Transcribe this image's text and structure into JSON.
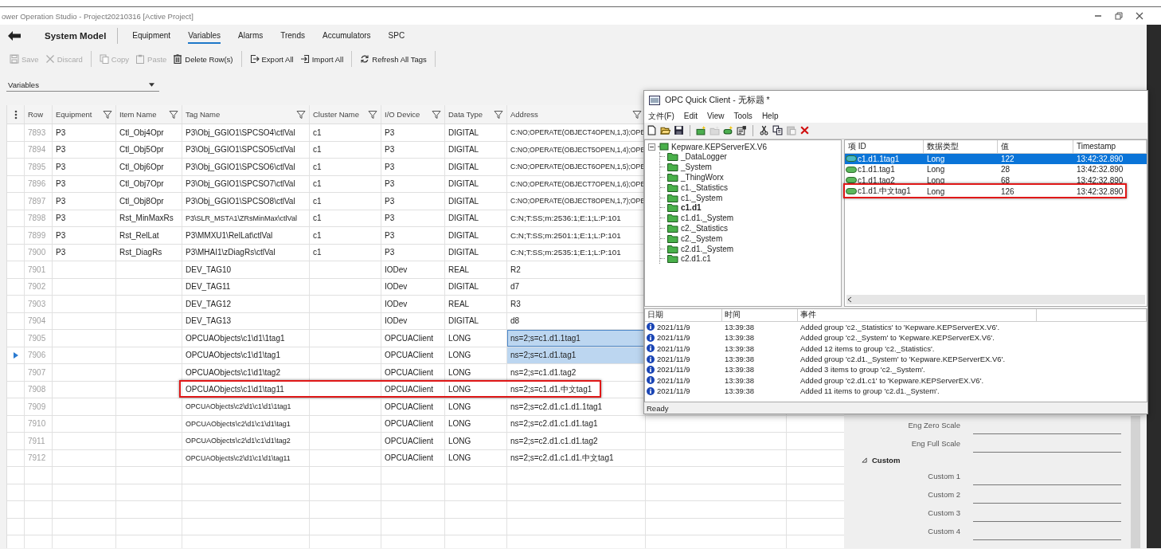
{
  "window": {
    "title": "ower Operation Studio - Project20210316 [Active Project]"
  },
  "nav": {
    "title": "System Model",
    "tabs": [
      {
        "label": "Equipment",
        "selected": false
      },
      {
        "label": "Variables",
        "selected": true
      },
      {
        "label": "Alarms",
        "selected": false
      },
      {
        "label": "Trends",
        "selected": false
      },
      {
        "label": "Accumulators",
        "selected": false
      },
      {
        "label": "SPC",
        "selected": false
      }
    ]
  },
  "toolbar": {
    "groups": [
      {
        "buttons": [
          {
            "kind": "save",
            "label": "Save",
            "disabled": true
          },
          {
            "kind": "discard",
            "label": "Discard",
            "disabled": true
          }
        ]
      },
      {
        "buttons": [
          {
            "kind": "copy",
            "label": "Copy",
            "disabled": true
          },
          {
            "kind": "paste",
            "label": "Paste",
            "disabled": true
          },
          {
            "kind": "delete",
            "label": "Delete Row(s)",
            "disabled": false
          }
        ]
      },
      {
        "buttons": [
          {
            "kind": "export",
            "label": "Export All",
            "disabled": false
          },
          {
            "kind": "import",
            "label": "Import All",
            "disabled": false
          }
        ]
      },
      {
        "buttons": [
          {
            "kind": "refresh",
            "label": "Refresh All Tags",
            "disabled": false
          }
        ]
      }
    ]
  },
  "filter": {
    "value": "Variables"
  },
  "table": {
    "columns": [
      {
        "label": "Row",
        "filter": false
      },
      {
        "label": "Equipment",
        "filter": true
      },
      {
        "label": "Item Name",
        "filter": true
      },
      {
        "label": "Tag Name",
        "filter": true
      },
      {
        "label": "Cluster Name",
        "filter": true
      },
      {
        "label": "I/O Device",
        "filter": true
      },
      {
        "label": "Data Type",
        "filter": true
      },
      {
        "label": "Address",
        "filter": true
      }
    ],
    "rows": [
      {
        "row": "7893",
        "equipment": "P3",
        "item_name": "Ctl_Obj4Opr",
        "tag_name": "P3\\Obj_GGIO1\\SPCSO4\\ctlVal",
        "cluster_name": "c1",
        "io_device": "P3",
        "data_type": "DIGITAL",
        "address": "C:NO;OPERATE(OBJECT4OPEN,1,3);OPE",
        "selected": false,
        "current": false,
        "outlined": false
      },
      {
        "row": "7894",
        "equipment": "P3",
        "item_name": "Ctl_Obj5Opr",
        "tag_name": "P3\\Obj_GGIO1\\SPCSO5\\ctlVal",
        "cluster_name": "c1",
        "io_device": "P3",
        "data_type": "DIGITAL",
        "address": "C:NO;OPERATE(OBJECT5OPEN,1,4);OPE",
        "selected": false,
        "current": false,
        "outlined": false
      },
      {
        "row": "7895",
        "equipment": "P3",
        "item_name": "Ctl_Obj6Opr",
        "tag_name": "P3\\Obj_GGIO1\\SPCSO6\\ctlVal",
        "cluster_name": "c1",
        "io_device": "P3",
        "data_type": "DIGITAL",
        "address": "C:NO;OPERATE(OBJECT6OPEN,1,5);OPE",
        "selected": false,
        "current": false,
        "outlined": false
      },
      {
        "row": "7896",
        "equipment": "P3",
        "item_name": "Ctl_Obj7Opr",
        "tag_name": "P3\\Obj_GGIO1\\SPCSO7\\ctlVal",
        "cluster_name": "c1",
        "io_device": "P3",
        "data_type": "DIGITAL",
        "address": "C:NO;OPERATE(OBJECT7OPEN,1,6);OPE",
        "selected": false,
        "current": false,
        "outlined": false
      },
      {
        "row": "7897",
        "equipment": "P3",
        "item_name": "Ctl_Obj8Opr",
        "tag_name": "P3\\Obj_GGIO1\\SPCSO8\\ctlVal",
        "cluster_name": "c1",
        "io_device": "P3",
        "data_type": "DIGITAL",
        "address": "C:NO;OPERATE(OBJECT8OPEN,1,7);OPE",
        "selected": false,
        "current": false,
        "outlined": false
      },
      {
        "row": "7898",
        "equipment": "P3",
        "item_name": "Rst_MinMaxRs",
        "tag_name": "P3\\SLR_MSTA1\\ZRsMinMax\\ctlVal",
        "cluster_name": "c1",
        "io_device": "P3",
        "data_type": "DIGITAL",
        "address": "C:N;T:SS;m:2536:1;E:1;L:P:101",
        "selected": false,
        "current": false,
        "outlined": false
      },
      {
        "row": "7899",
        "equipment": "P3",
        "item_name": "Rst_RelLat",
        "tag_name": "P3\\MMXU1\\RelLat\\ctlVal",
        "cluster_name": "c1",
        "io_device": "P3",
        "data_type": "DIGITAL",
        "address": "C:N;T:SS;m:2501:1;E:1;L:P:101",
        "selected": false,
        "current": false,
        "outlined": false
      },
      {
        "row": "7900",
        "equipment": "P3",
        "item_name": "Rst_DiagRs",
        "tag_name": "P3\\MHAI1\\zDiagRs\\ctlVal",
        "cluster_name": "c1",
        "io_device": "P3",
        "data_type": "DIGITAL",
        "address": "C:N;T:SS;m:2535:1;E:1;L:P:101",
        "selected": false,
        "current": false,
        "outlined": false
      },
      {
        "row": "7901",
        "tag_name": "DEV_TAG10",
        "io_device": "IODev",
        "data_type": "REAL",
        "address": "R2",
        "selected": false,
        "current": false,
        "outlined": false
      },
      {
        "row": "7902",
        "tag_name": "DEV_TAG11",
        "io_device": "IODev",
        "data_type": "DIGITAL",
        "address": "d7",
        "selected": false,
        "current": false,
        "outlined": false
      },
      {
        "row": "7903",
        "tag_name": "DEV_TAG12",
        "io_device": "IODev",
        "data_type": "REAL",
        "address": "R3",
        "selected": false,
        "current": false,
        "outlined": false
      },
      {
        "row": "7904",
        "tag_name": "DEV_TAG13",
        "io_device": "IODev",
        "data_type": "DIGITAL",
        "address": "d8",
        "selected": false,
        "current": false,
        "outlined": false
      },
      {
        "row": "7905",
        "tag_name": "OPCUAObjects\\c1\\d1\\1tag1",
        "io_device": "OPCUAClient",
        "data_type": "LONG",
        "address": "ns=2;s=c1.d1.1tag1",
        "selected": true,
        "current": false,
        "outlined": false
      },
      {
        "row": "7906",
        "tag_name": "OPCUAObjects\\c1\\d1\\tag1",
        "io_device": "OPCUAClient",
        "data_type": "LONG",
        "address": "ns=2;s=c1.d1.tag1",
        "selected": true,
        "current": true,
        "outlined": false
      },
      {
        "row": "7907",
        "tag_name": "OPCUAObjects\\c1\\d1\\tag2",
        "io_device": "OPCUAClient",
        "data_type": "LONG",
        "address": "ns=2;s=c1.d1.tag2",
        "selected": false,
        "current": false,
        "outlined": false
      },
      {
        "row": "7908",
        "tag_name": "OPCUAObjects\\c1\\d1\\tag11",
        "io_device": "OPCUAClient",
        "data_type": "LONG",
        "address": "ns=2;s=c1.d1.中文tag1",
        "selected": false,
        "current": false,
        "outlined": true
      },
      {
        "row": "7909",
        "tag_name": "OPCUAObjects\\c2\\d1\\c1\\d1\\1tag1",
        "io_device": "OPCUAClient",
        "data_type": "LONG",
        "address": "ns=2;s=c2.d1.c1.d1.1tag1",
        "selected": false,
        "current": false,
        "outlined": false
      },
      {
        "row": "7910",
        "tag_name": "OPCUAObjects\\c2\\d1\\c1\\d1\\tag1",
        "io_device": "OPCUAClient",
        "data_type": "LONG",
        "address": "ns=2;s=c2.d1.c1.d1.tag1",
        "selected": false,
        "current": false,
        "outlined": false
      },
      {
        "row": "7911",
        "tag_name": "OPCUAObjects\\c2\\d1\\c1\\d1\\tag2",
        "io_device": "OPCUAClient",
        "data_type": "LONG",
        "address": "ns=2;s=c2.d1.c1.d1.tag2",
        "selected": false,
        "current": false,
        "outlined": false
      },
      {
        "row": "7912",
        "tag_name": "OPCUAObjects\\c2\\d1\\c1\\d1\\tag11",
        "io_device": "OPCUAClient",
        "data_type": "LONG",
        "address": "ns=2;s=c2.d1.c1.d1.中文tag1",
        "selected": false,
        "current": false,
        "outlined": false
      }
    ]
  },
  "properties": {
    "items": [
      {
        "kind": "field",
        "label": "Eng Zero Scale"
      },
      {
        "kind": "field",
        "label": "Eng Full Scale"
      },
      {
        "kind": "section",
        "label": "Custom",
        "expanded": true
      },
      {
        "kind": "field",
        "label": "Custom 1"
      },
      {
        "kind": "field",
        "label": "Custom 2"
      },
      {
        "kind": "field",
        "label": "Custom 3"
      },
      {
        "kind": "field",
        "label": "Custom 4"
      }
    ]
  },
  "opc_client": {
    "title": "OPC Quick Client - 无标题 *",
    "menu": [
      "文件(F)",
      "Edit",
      "View",
      "Tools",
      "Help"
    ],
    "toolbar": [
      {
        "kind": "new",
        "disabled": false
      },
      {
        "kind": "open",
        "disabled": false
      },
      {
        "kind": "save",
        "disabled": false
      },
      {
        "kind": "separator"
      },
      {
        "kind": "server",
        "disabled": false
      },
      {
        "kind": "group",
        "disabled": true
      },
      {
        "kind": "item",
        "disabled": false
      },
      {
        "kind": "properties",
        "disabled": false
      },
      {
        "kind": "separator"
      },
      {
        "kind": "cut",
        "disabled": false
      },
      {
        "kind": "copy",
        "disabled": false
      },
      {
        "kind": "paste",
        "disabled": true
      },
      {
        "kind": "delete",
        "disabled": false
      }
    ],
    "tree": {
      "label": "Kepware.KEPServerEX.V6",
      "expanded": true,
      "children": [
        {
          "label": "_DataLogger",
          "selected": false
        },
        {
          "label": "_System",
          "selected": false
        },
        {
          "label": "_ThingWorx",
          "selected": false
        },
        {
          "label": "c1._Statistics",
          "selected": false
        },
        {
          "label": "c1._System",
          "selected": false
        },
        {
          "label": "c1.d1",
          "selected": true
        },
        {
          "label": "c1.d1._System",
          "selected": false
        },
        {
          "label": "c2._Statistics",
          "selected": false
        },
        {
          "label": "c2._System",
          "selected": false
        },
        {
          "label": "c2.d1._System",
          "selected": false
        },
        {
          "label": "c2.d1.c1",
          "selected": false
        }
      ]
    },
    "items": {
      "columns": [
        "项 ID",
        "数据类型",
        "值",
        "Timestamp"
      ],
      "rows": [
        {
          "id": "c1.d1.1tag1",
          "type": "Long",
          "value": "122",
          "timestamp": "13:42:32.890",
          "selected": true,
          "outlined": false
        },
        {
          "id": "c1.d1.tag1",
          "type": "Long",
          "value": "28",
          "timestamp": "13:42:32.890",
          "selected": false,
          "outlined": false
        },
        {
          "id": "c1.d1.tag2",
          "type": "Long",
          "value": "68",
          "timestamp": "13:42:32.890",
          "selected": false,
          "outlined": false
        },
        {
          "id": "c1.d1.中文tag1",
          "type": "Long",
          "value": "126",
          "timestamp": "13:42:32.890",
          "selected": false,
          "outlined": true
        }
      ]
    },
    "log": {
      "columns": [
        "日期",
        "时间",
        "事件"
      ],
      "rows": [
        {
          "date": "2021/11/9",
          "time": "13:39:38",
          "event": "Added group 'c2._Statistics' to 'Kepware.KEPServerEX.V6'."
        },
        {
          "date": "2021/11/9",
          "time": "13:39:38",
          "event": "Added group 'c2._System' to 'Kepware.KEPServerEX.V6'."
        },
        {
          "date": "2021/11/9",
          "time": "13:39:38",
          "event": "Added 12 items to group 'c2._Statistics'."
        },
        {
          "date": "2021/11/9",
          "time": "13:39:38",
          "event": "Added group 'c2.d1._System' to 'Kepware.KEPServerEX.V6'."
        },
        {
          "date": "2021/11/9",
          "time": "13:39:38",
          "event": "Added 3 items to group 'c2._System'."
        },
        {
          "date": "2021/11/9",
          "time": "13:39:38",
          "event": "Added group 'c2.d1.c1' to 'Kepware.KEPServerEX.V6'."
        },
        {
          "date": "2021/11/9",
          "time": "13:39:38",
          "event": "Added 11 items to group 'c2.d1._System'."
        }
      ]
    },
    "status": "Ready"
  }
}
